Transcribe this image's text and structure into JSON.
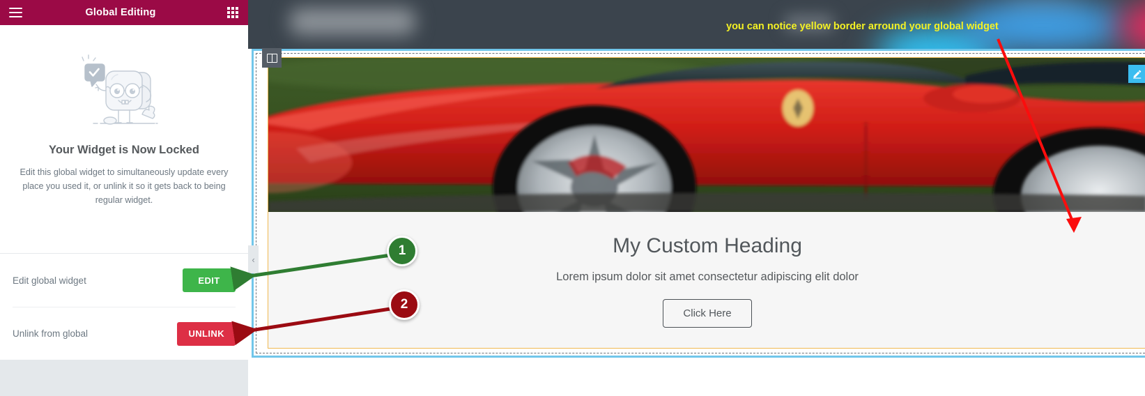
{
  "panel": {
    "title": "Global Editing",
    "menu_icon": "hamburger-menu-icon",
    "grid_icon": "apps-grid-icon",
    "collapse_icon": "‹",
    "empty_state": {
      "illustration": "mascot-widget-locked-illustration",
      "title": "Your Widget is Now Locked",
      "description": "Edit this global widget to simultaneously update every place you used it, or unlink it so it gets back to being regular widget."
    },
    "actions": [
      {
        "label": "Edit global widget",
        "button": "EDIT",
        "color": "#3eb54a",
        "name": "edit-global-widget"
      },
      {
        "label": "Unlink from global",
        "button": "UNLINK",
        "color": "#dd2f45",
        "name": "unlink-from-global"
      }
    ]
  },
  "canvas": {
    "annotation": "you can notice yellow border arround your global widget",
    "annotation_color": "#f4f124",
    "column_handle_icon": "columns-handle-icon",
    "edit_pencil_icon": "pencil-edit-icon",
    "section_border_color": "#71c6ea",
    "widget_border_color": "#f0b952",
    "widget": {
      "image_alt": "red-sports-car-image",
      "heading": "My Custom Heading",
      "subheading": "Lorem ipsum dolor sit amet consectetur adipiscing elit dolor",
      "cta_label": "Click Here"
    }
  },
  "callouts": [
    {
      "number": "1",
      "color": "#2f7d32",
      "target": "edit-button"
    },
    {
      "number": "2",
      "color": "#9b0b12",
      "target": "unlink-button"
    }
  ]
}
